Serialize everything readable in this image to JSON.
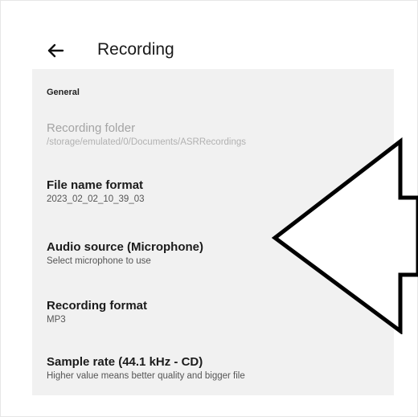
{
  "header": {
    "back_icon": "arrow-left-icon",
    "title": "Recording"
  },
  "sections": [
    {
      "title": "General",
      "items": [
        {
          "label": "Recording folder",
          "value": "/storage/emulated/0/Documents/ASRRecordings",
          "enabled": false
        },
        {
          "label": "File name format",
          "value": "2023_02_02_10_39_03",
          "enabled": true
        },
        {
          "label": "Audio source (Microphone)",
          "value": "Select microphone to use",
          "enabled": true
        },
        {
          "label": "Recording format",
          "value": "MP3",
          "enabled": true
        },
        {
          "label": "Sample rate (44.1 kHz - CD)",
          "value": "Higher value means better quality and bigger file",
          "enabled": true
        }
      ]
    }
  ],
  "overlay": {
    "arrow_icon": "left-pointing-arrow-icon",
    "colors": {
      "fill": "#ffffff",
      "stroke": "#000000"
    }
  }
}
